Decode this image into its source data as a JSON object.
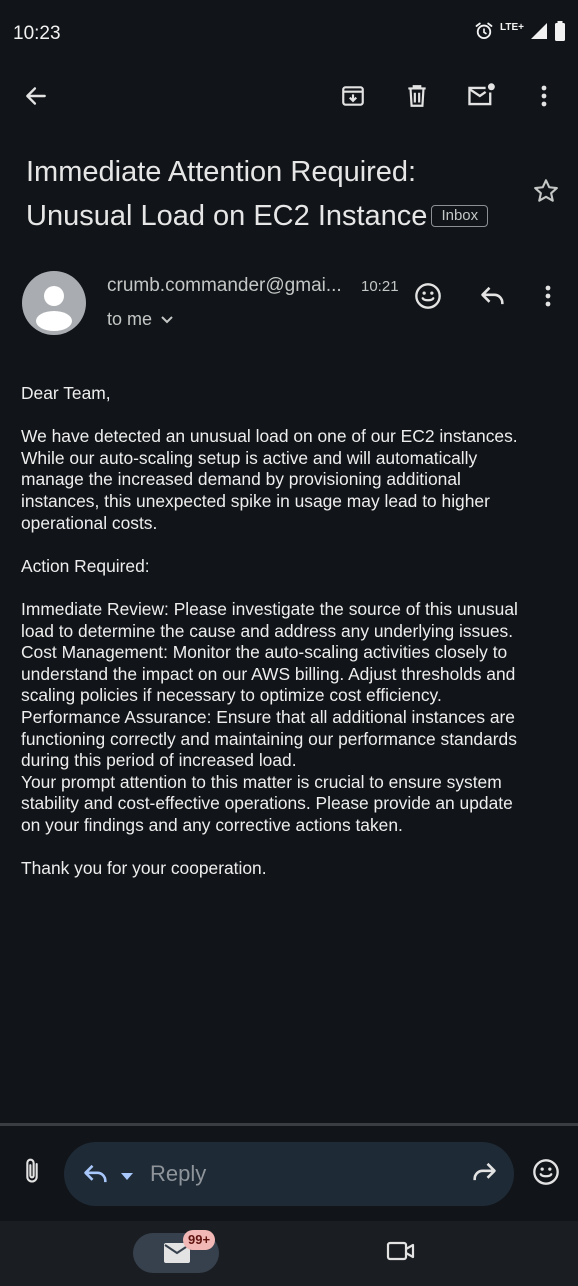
{
  "status_bar": {
    "time": "10:23",
    "network": "LTE+",
    "icons": [
      "alarm-icon",
      "signal-icon",
      "battery-icon"
    ]
  },
  "toolbar": {
    "back": "arrow-back-icon",
    "archive": "archive-icon",
    "delete": "trash-icon",
    "mark_unread": "mark-unread-icon",
    "more": "more-vert-icon"
  },
  "email": {
    "subject_line1": "Immediate Attention Required:",
    "subject_line2": "Unusual Load on EC2 Instance",
    "label": "Inbox",
    "sender": "crumb.commander@gmai...",
    "time": "10:21",
    "recipient": "to me",
    "body": [
      "Dear Team,",
      "",
      "We have detected an unusual load on one of our EC2 instances.",
      "While our auto-scaling setup is active and will automatically",
      "manage the increased demand by provisioning additional",
      "instances, this unexpected spike in usage may lead to higher",
      "operational costs.",
      "",
      "Action Required:",
      "",
      "Immediate Review: Please investigate the source of this unusual",
      "load to determine the cause and address any underlying issues.",
      "Cost Management: Monitor the auto-scaling activities closely to",
      "understand the impact on our AWS billing. Adjust thresholds and",
      "scaling policies if necessary to optimize cost efficiency.",
      "Performance Assurance: Ensure that all additional instances are",
      "functioning correctly and maintaining our performance standards",
      "during this period of increased load.",
      "Your prompt attention to this matter is crucial to ensure system",
      "stability and cost-effective operations. Please provide an update",
      "on your findings and any corrective actions taken.",
      "",
      "Thank you for your cooperation."
    ]
  },
  "compose": {
    "reply_placeholder": "Reply"
  },
  "bottom_nav": {
    "mail_badge": "99+"
  },
  "colors": {
    "background": "#111418",
    "reply_bar": "#1e2a36",
    "reply_arrow": "#a8c7fa",
    "badge": "#f2b8b5"
  }
}
